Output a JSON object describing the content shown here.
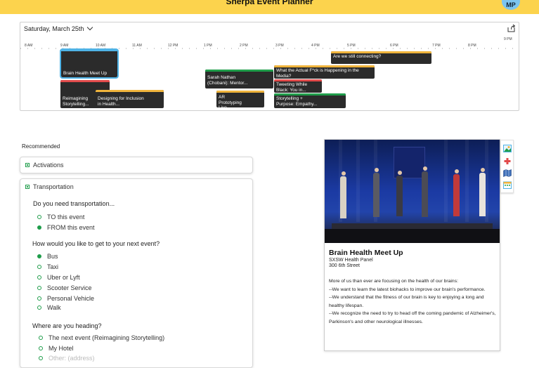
{
  "app": {
    "title": "Sherpa Event Planner",
    "avatar_initials": "MP"
  },
  "timeline": {
    "date_label": "Saturday, March 25th",
    "hours": [
      "8 AM",
      "9 AM",
      "10 AM",
      "11 AM",
      "12 PM",
      "1 PM",
      "2 PM",
      "3 PM",
      "4 PM",
      "5 PM",
      "6 PM",
      "7 PM",
      "8 PM"
    ],
    "extra_hour_label": "9 PM",
    "events": [
      {
        "title": "Brain Health Meet Up",
        "band": "#4fb3e6",
        "selected": true
      },
      {
        "title": "Reimagining Storytelling...",
        "band": "#e24b4b"
      },
      {
        "title": "Designing for Inclusion in Health...",
        "band": "#f0b43c"
      },
      {
        "title": "Sarah Nathan (Chobani): Mentor...",
        "band": "#1f9d4a"
      },
      {
        "title": "AR Prototyping Live",
        "band": "#f0b43c"
      },
      {
        "title": "What the Actual F*ck is Happening in the Media?",
        "band": "#f0b43c"
      },
      {
        "title": "Tweeting While Black: You in...",
        "band": "#e24b4b"
      },
      {
        "title": "Storytelling + Purpose: Empathy...",
        "band": "#1f9d4a"
      },
      {
        "title": "Are we still connecting?",
        "band": "#f0b43c"
      }
    ]
  },
  "recommended": {
    "title": "Recommended",
    "activations_label": "Activations",
    "transportation": {
      "label": "Transportation",
      "q1": "Do you need transportation...",
      "q1_options": [
        {
          "label": "TO this event",
          "selected": false
        },
        {
          "label": "FROM this event",
          "selected": true
        }
      ],
      "q2": "How would you like to get to your next event?",
      "q2_options": [
        {
          "label": "Bus",
          "selected": true
        },
        {
          "label": "Taxi",
          "selected": false
        },
        {
          "label": "Uber or Lyft",
          "selected": false
        },
        {
          "label": "Scooter Service",
          "selected": false
        },
        {
          "label": "Personal Vehicle",
          "selected": false
        },
        {
          "label": "Walk",
          "selected": false
        }
      ],
      "q3": "Where are you heading?",
      "q3_options": [
        {
          "label": "The next event (Reimagining Storytelling)",
          "selected": false
        },
        {
          "label": "My Hotel",
          "selected": false
        }
      ],
      "q3_other_placeholder": "Other: (address)"
    }
  },
  "detail": {
    "title": "Brain Health Meet Up",
    "subtitle": "SXSW Health Panel",
    "address": "300 6th Street",
    "description_lines": [
      "More of us than ever are focusing on the health of our brains:",
      "--We want to learn the latest biohacks to improve our brain's performance.",
      "--We understand that the fitness of our brain is key to enjoying a long and healthy lifespan.",
      "--We recognize the need to try to head off the coming pandemic of Alzheimer's, Parkinson's and other neurological illnesses."
    ]
  },
  "icons": {
    "share": "share-icon",
    "tools": [
      "image-icon",
      "health-cross-icon",
      "map-icon",
      "calendar-icon"
    ]
  }
}
